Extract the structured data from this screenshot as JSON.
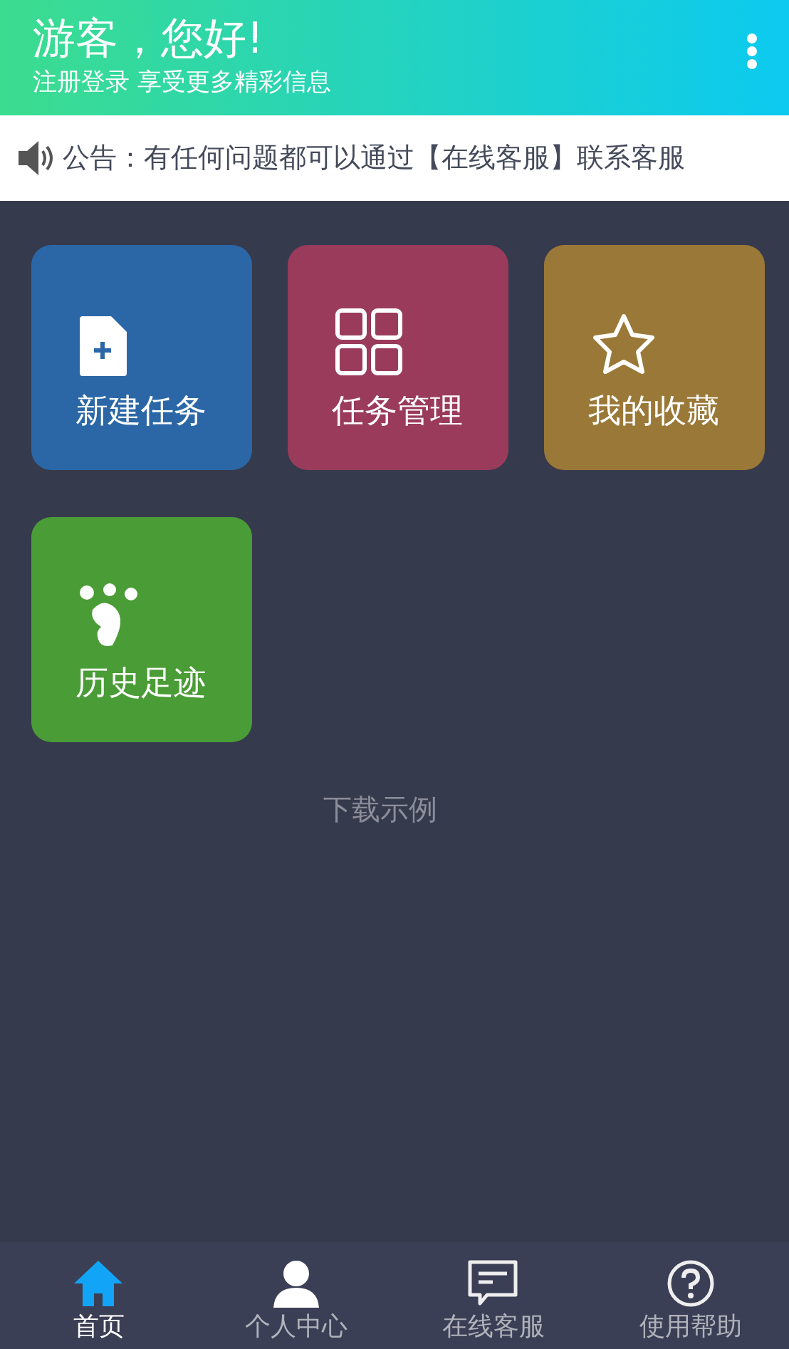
{
  "header": {
    "title": "游客，您好!",
    "subtitle": "注册登录 享受更多精彩信息"
  },
  "notice": {
    "text": "公告：有任何问题都可以通过【在线客服】联系客服"
  },
  "tiles": [
    {
      "label": "新建任务",
      "kind": "new",
      "color": "#2b67a7"
    },
    {
      "label": "任务管理",
      "kind": "grid",
      "color": "#9a3b5c"
    },
    {
      "label": "我的收藏",
      "kind": "star",
      "color": "#9a7837"
    },
    {
      "label": "历史足迹",
      "kind": "foot",
      "color": "#4a9c36"
    }
  ],
  "download_link": "下载示例",
  "tabs": [
    {
      "label": "首页",
      "kind": "home",
      "selected": true
    },
    {
      "label": "个人中心",
      "kind": "person",
      "selected": false
    },
    {
      "label": "在线客服",
      "kind": "chat",
      "selected": false
    },
    {
      "label": "使用帮助",
      "kind": "help",
      "selected": false
    }
  ]
}
